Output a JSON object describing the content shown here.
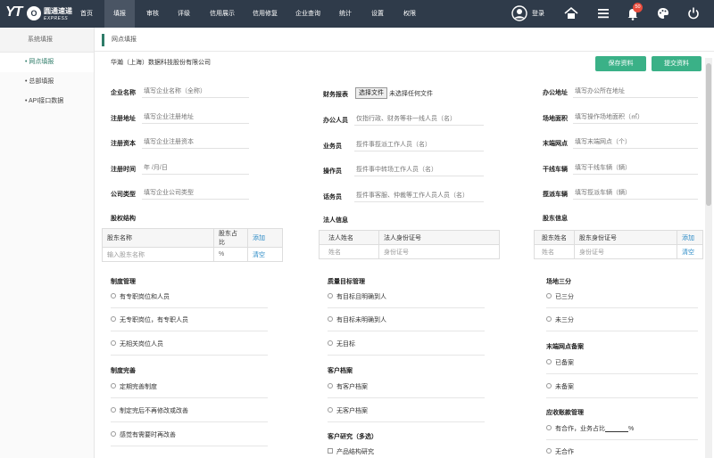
{
  "brand": {
    "logo_text": "YT",
    "logo_mark": "O",
    "cn_name": "圆通速递",
    "en_name": "EXPRESS"
  },
  "nav": [
    {
      "label": "首页"
    },
    {
      "label": "填报"
    },
    {
      "label": "审核"
    },
    {
      "label": "评级"
    },
    {
      "label": "信用展示"
    },
    {
      "label": "信用修复"
    },
    {
      "label": "企业查询"
    },
    {
      "label": "统计"
    },
    {
      "label": "设置"
    },
    {
      "label": "权限"
    }
  ],
  "user": {
    "login_label": "登录",
    "notification_count": "50"
  },
  "colors": {
    "topbar": "#2f3b4a",
    "accent": "#3ab187",
    "link": "#2a8ac6",
    "badge": "#e84c3d"
  },
  "sidebar": {
    "title": "系统填报",
    "items": [
      {
        "label": "• 网点填报"
      },
      {
        "label": "• 总部填报"
      },
      {
        "label": "• API接口数据"
      }
    ]
  },
  "breadcrumb": "网点填报",
  "company_name": "华瀚（上海）数据科技股份有限公司",
  "buttons": {
    "save": "保存资料",
    "submit": "提交资料"
  },
  "form": {
    "col1": [
      {
        "label": "企业名称",
        "placeholder": "填写企业名称（全称）"
      },
      {
        "label": "注册地址",
        "placeholder": "填写企业注册地址"
      },
      {
        "label": "注册资本",
        "placeholder": "填写企业注册资本"
      },
      {
        "label": "注册时间",
        "placeholder": "年 /月/日"
      },
      {
        "label": "公司类型",
        "placeholder": "填写企业公司类型"
      }
    ],
    "col2": [
      {
        "label": "财务报表",
        "button": "选择文件",
        "file_status": "未选择任何文件"
      },
      {
        "label": "办公人员",
        "placeholder": "仅指行政、财务等非一线人员（名）"
      },
      {
        "label": "业务员",
        "placeholder": "揽件事揽派工作人员（名）"
      },
      {
        "label": "操作员",
        "placeholder": "揽件事中转场工作人员（名）"
      },
      {
        "label": "话务员",
        "placeholder": "揽件事客服、仲裁等工作人员人员（名）"
      }
    ],
    "col3": [
      {
        "label": "办公地址",
        "placeholder": "填写办公所在地址"
      },
      {
        "label": "场地面积",
        "placeholder": "填写操作场地面积（㎡）"
      },
      {
        "label": "末端网点",
        "placeholder": "填写末端网点（个）"
      },
      {
        "label": "干线车辆",
        "placeholder": "填写干线车辆（辆）"
      },
      {
        "label": "揽派车辆",
        "placeholder": "填写揽派车辆（辆）"
      }
    ]
  },
  "equity": {
    "title": "股权结构",
    "headers": [
      "股东名称",
      "股东占比",
      "添加"
    ],
    "row": [
      "输入股东名称",
      "%",
      "清空"
    ]
  },
  "legal": {
    "title": "法人信息",
    "headers": [
      "法人姓名",
      "法人身份证号"
    ],
    "row": [
      "姓名",
      "身份证号"
    ]
  },
  "shareholder": {
    "title": "股东信息",
    "headers": [
      "股东姓名",
      "股东身份证号",
      "添加"
    ],
    "row": [
      "姓名",
      "身份证号",
      "清空"
    ]
  },
  "sections": {
    "system_mgmt": {
      "title": "制度管理",
      "options": [
        "有专职岗位和人员",
        "无专职岗位，有专职人员",
        "无相关岗位人员"
      ]
    },
    "system_improve": {
      "title": "制度完善",
      "options": [
        "定期完善制度",
        "制定完后不再修改或改善",
        "感觉有需要时再改善"
      ]
    },
    "quality": {
      "title": "质量目标管理",
      "options": [
        "有目标且明确到人",
        "有目标未明确到人",
        "无目标"
      ]
    },
    "customer_archive": {
      "title": "客户档案",
      "options": [
        "有客户档案",
        "无客户档案"
      ]
    },
    "customer_research": {
      "title": "客户研究（多选）",
      "options": [
        "产品结构研究"
      ]
    },
    "site_split": {
      "title": "场地三分",
      "options": [
        "已三分",
        "未三分"
      ]
    },
    "terminal_record": {
      "title": "末端网点备案",
      "options": [
        "已备案",
        "未备案"
      ]
    },
    "receivable": {
      "title": "应收账款管理",
      "options": [
        "有合作，业务占比",
        "无合作"
      ],
      "unit": "%"
    }
  }
}
